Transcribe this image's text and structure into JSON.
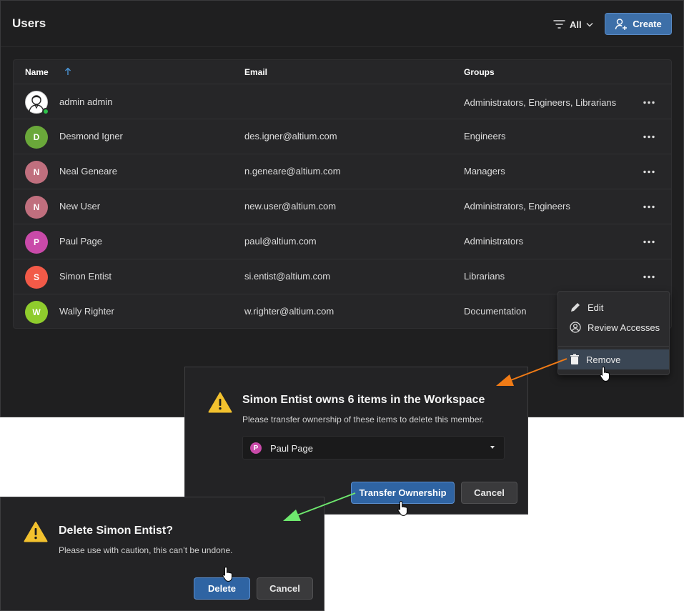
{
  "header": {
    "title": "Users",
    "filter_label": "All",
    "create_label": "Create"
  },
  "table": {
    "columns": {
      "name": "Name",
      "email": "Email",
      "groups": "Groups"
    },
    "rows": [
      {
        "name": "admin admin",
        "email": "",
        "groups": "Administrators, Engineers, Librarians",
        "initial": "",
        "color": "#ffffff"
      },
      {
        "name": "Desmond Igner",
        "email": "des.igner@altium.com",
        "groups": "Engineers",
        "initial": "D",
        "color": "#6aa83a"
      },
      {
        "name": "Neal Geneare",
        "email": "n.geneare@altium.com",
        "groups": "Managers",
        "initial": "N",
        "color": "#c06f7e"
      },
      {
        "name": "New User",
        "email": "new.user@altium.com",
        "groups": "Administrators, Engineers",
        "initial": "N",
        "color": "#c06f7e"
      },
      {
        "name": "Paul Page",
        "email": "paul@altium.com",
        "groups": "Administrators",
        "initial": "P",
        "color": "#c94aa9"
      },
      {
        "name": "Simon Entist",
        "email": "si.entist@altium.com",
        "groups": "Librarians",
        "initial": "S",
        "color": "#f25a48"
      },
      {
        "name": "Wally Righter",
        "email": "w.righter@altium.com",
        "groups": "Documentation",
        "initial": "W",
        "color": "#8fcc2d"
      }
    ]
  },
  "context_menu": {
    "edit": "Edit",
    "review": "Review Accesses",
    "remove": "Remove"
  },
  "transfer_dialog": {
    "title": "Simon Entist owns 6 items in the Workspace",
    "text": "Please transfer ownership of these items to delete this member.",
    "selected_user": "Paul Page",
    "selected_initial": "P",
    "transfer_label": "Transfer Ownership",
    "cancel_label": "Cancel"
  },
  "delete_dialog": {
    "title": "Delete Simon Entist?",
    "text": "Please use with caution, this can’t be undone.",
    "delete_label": "Delete",
    "cancel_label": "Cancel"
  },
  "colors": {
    "accent": "#3d6fa8",
    "warning": "#f2c12e",
    "online": "#2ec24a",
    "arrow_orange": "#f07b16",
    "arrow_green": "#6ee86e"
  },
  "icons": [
    "filter-icon",
    "chevron-down-icon",
    "add-user-icon",
    "sort-ascending-icon",
    "more-icon",
    "pencil-icon",
    "user-circle-icon",
    "trash-icon",
    "warning-icon",
    "caret-down-icon",
    "hand-cursor-icon"
  ]
}
